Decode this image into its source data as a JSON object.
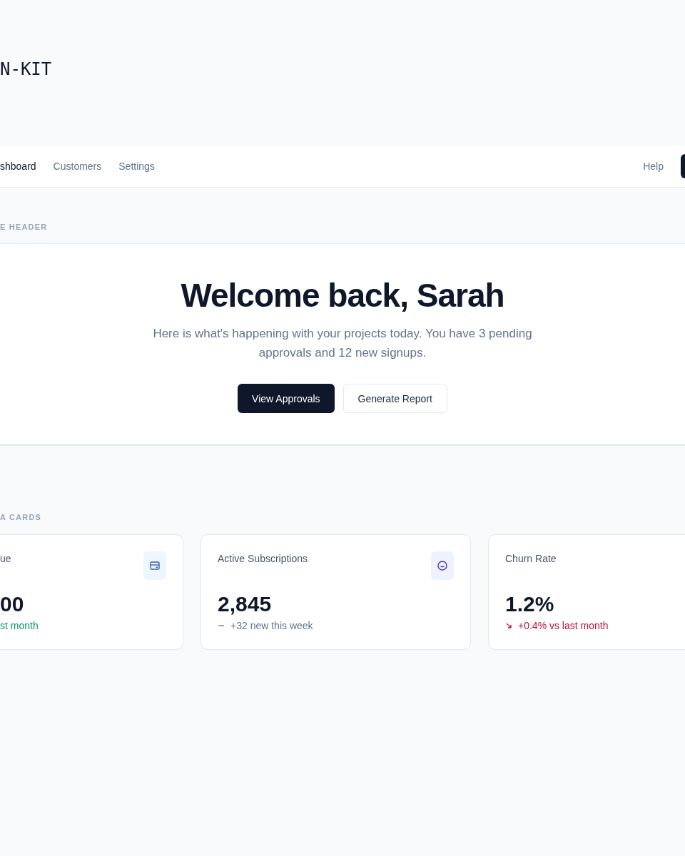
{
  "logo": "N-KIT",
  "nav": {
    "items": [
      {
        "label": "shboard",
        "selected": true
      },
      {
        "label": "Customers",
        "selected": false
      },
      {
        "label": "Settings",
        "selected": false
      }
    ],
    "help": "Help"
  },
  "hero_section": {
    "label": "E HEADER",
    "title": "Welcome back, Sarah",
    "subtitle": "Here is what's happening with your projects today. You have 3 pending approvals and 12 new signups.",
    "buttons": [
      {
        "label": "View Approvals",
        "kind": "primary"
      },
      {
        "label": "Generate Report",
        "kind": "secondary"
      }
    ]
  },
  "cards_section": {
    "label": "A CARDS",
    "cards": [
      {
        "title": "ue",
        "value": "00",
        "trend": "st month",
        "kind": "up"
      },
      {
        "title": "Active Subscriptions",
        "value": "2,845",
        "trend": "+32 new this week",
        "kind": "neutral"
      },
      {
        "title": "Churn Rate",
        "value": "1.2%",
        "trend": "+0.4% vs last month",
        "kind": "down"
      }
    ]
  }
}
